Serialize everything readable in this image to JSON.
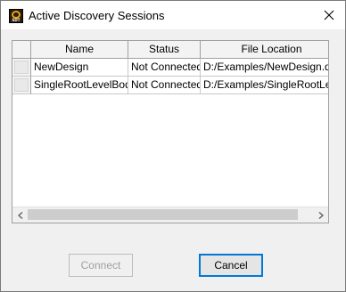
{
  "window": {
    "title": "Active Discovery Sessions",
    "icon": "app-logo-icon",
    "icon_caption": "SDT"
  },
  "table": {
    "columns": [
      "Name",
      "Status",
      "File Location"
    ],
    "rows": [
      {
        "name": "NewDesign",
        "status": "Not Connected",
        "location": "D:/Examples/NewDesign.dsco"
      },
      {
        "name": "SingleRootLevelBody",
        "status": "Not Connected",
        "location": "D:/Examples/SingleRootLevelBody"
      }
    ]
  },
  "buttons": {
    "connect": "Connect",
    "cancel": "Cancel"
  },
  "colors": {
    "accent": "#0078d7",
    "disabled_text": "#a0a0a0"
  }
}
